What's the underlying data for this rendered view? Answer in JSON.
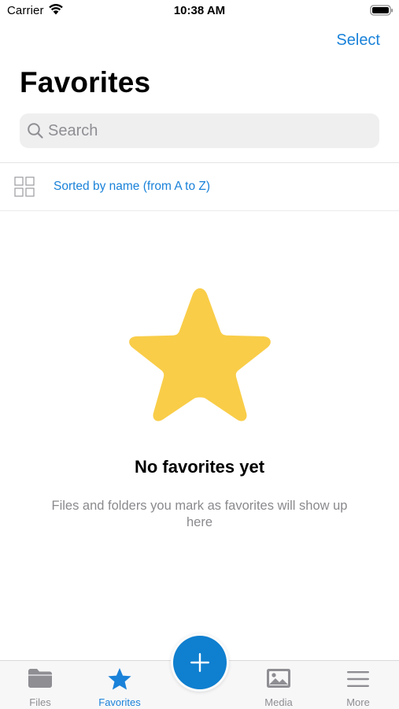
{
  "status_bar": {
    "carrier": "Carrier",
    "time": "10:38 AM",
    "icons": [
      "wifi-icon",
      "battery-icon"
    ]
  },
  "nav": {
    "select_label": "Select",
    "title": "Favorites"
  },
  "search": {
    "placeholder": "Search",
    "value": "",
    "icon": "search-icon"
  },
  "sort": {
    "icon": "grid-view-icon",
    "label": "Sorted by name (from A to Z)"
  },
  "empty_state": {
    "icon": "star-icon",
    "title": "No favorites yet",
    "subtitle": "Files and folders you mark as favorites will show up here"
  },
  "tab_bar": {
    "tabs": [
      {
        "label": "Files",
        "icon": "folder-icon",
        "active": false
      },
      {
        "label": "Favorites",
        "icon": "star-icon",
        "active": true
      },
      {
        "label": "Media",
        "icon": "image-icon",
        "active": false
      },
      {
        "label": "More",
        "icon": "menu-icon",
        "active": false
      }
    ],
    "fab_icon": "plus-icon"
  },
  "colors": {
    "accent": "#1a82d9",
    "fab": "#0f7fcf",
    "star": "#f9cd48",
    "inactive": "#8e8e93"
  }
}
